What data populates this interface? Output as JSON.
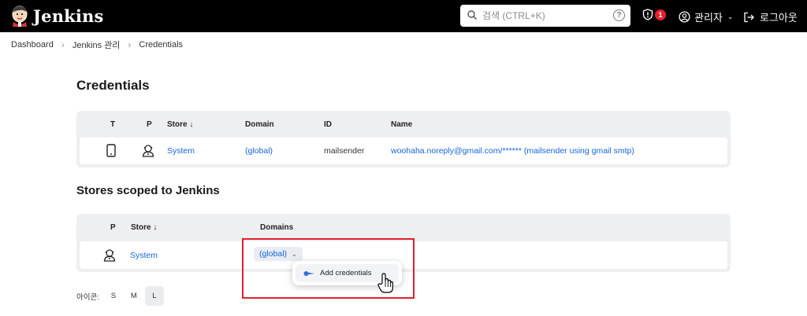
{
  "header": {
    "app_name": "Jenkins",
    "search_placeholder": "검색 (CTRL+K)",
    "help_glyph": "?",
    "alert_count": "1",
    "user_label": "관리자",
    "logout_label": "로그아웃"
  },
  "breadcrumb": [
    "Dashboard",
    "Jenkins 관리",
    "Credentials"
  ],
  "credentials": {
    "title": "Credentials",
    "columns": [
      "T",
      "P",
      "Store ↓",
      "Domain",
      "ID",
      "Name"
    ],
    "rows": [
      {
        "store": "System",
        "domain": "(global)",
        "id": "mailsender",
        "name": "woohaha.noreply@gmail.com/****** (mailsender using gmail smtp)"
      }
    ]
  },
  "stores": {
    "title": "Stores scoped to Jenkins",
    "columns": [
      "P",
      "Store ↓",
      "Domains"
    ],
    "rows": [
      {
        "store": "System",
        "domain_button": "(global)"
      }
    ]
  },
  "dropdown": {
    "items": [
      "Add credentials"
    ]
  },
  "icon_size": {
    "label": "아이콘:",
    "options": [
      "S",
      "M",
      "L"
    ],
    "selected": "L"
  },
  "colors": {
    "header_bg": "#000000",
    "link": "#1565d8",
    "highlight_border": "#e0202c",
    "badge": "#e5202e"
  },
  "icons": [
    "jenkins-logo",
    "search-icon",
    "help-icon",
    "shield-alert-icon",
    "user-circle-icon",
    "chevron-down-icon",
    "logout-icon",
    "phone-icon",
    "user-gear-icon",
    "key-icon",
    "hand-cursor-icon"
  ]
}
